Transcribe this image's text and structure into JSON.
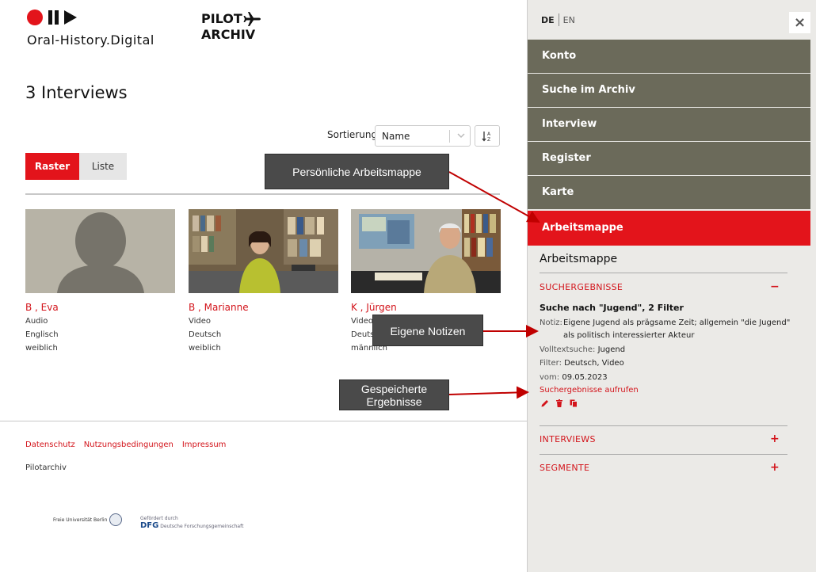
{
  "brand": {
    "ohd_text": "Oral-History.Digital",
    "pilot_line1": "PILOT",
    "pilot_line2": "ARCHIV"
  },
  "main": {
    "title": "3 Interviews",
    "sort_label": "Sortierung",
    "sort_value": "Name",
    "sort_button": "↓A Z",
    "view_raster": "Raster",
    "view_liste": "Liste"
  },
  "cards": [
    {
      "name": "B        , Eva",
      "media": "Audio",
      "language": "Englisch",
      "gender": "weiblich"
    },
    {
      "name": "B        , Marianne",
      "media": "Video",
      "language": "Deutsch",
      "gender": "weiblich"
    },
    {
      "name": "K           , Jürgen",
      "media": "Video",
      "language": "Deutsch",
      "gender": "männlich"
    }
  ],
  "footer": {
    "links": [
      "Datenschutz",
      "Nutzungsbedingungen",
      "Impressum"
    ],
    "brand": "Pilotarchiv",
    "fu_logo": "Freie Universität Berlin",
    "dfg_small": "Gefördert durch",
    "dfg_name": "DFG",
    "dfg_sub": "Deutsche Forschungsgemeinschaft"
  },
  "sidebar": {
    "lang_de": "DE",
    "lang_en": "EN",
    "close": "×",
    "nav": [
      "Konto",
      "Suche im Archiv",
      "Interview",
      "Register",
      "Karte",
      "Arbeitsmappe"
    ],
    "workbook_title": "Arbeitsmappe",
    "sections": {
      "results": "SUCHERGEBNISSE",
      "interviews": "INTERVIEWS",
      "segments": "SEGMENTE",
      "minus": "−",
      "plus": "+"
    },
    "saved_search": {
      "title": "Suche nach \"Jugend\", 2 Filter",
      "notiz_label": "Notiz:",
      "notiz_value": "Eigene Jugend als prägsame Zeit; allgemein \"die Jugend\" als politisch interessierter Akteur",
      "fulltext_label": "Volltextsuche:",
      "fulltext_value": "Jugend",
      "filter_label": "Filter:",
      "filter_value": "Deutsch, Video",
      "date_label": "vom:",
      "date_value": "09.05.2023",
      "open_link": "Suchergebnisse aufrufen"
    }
  },
  "callouts": {
    "workbook": "Persönliche Arbeitsmappe",
    "notes": "Eigene Notizen",
    "saved_line1": "Gespeicherte",
    "saved_line2": "Ergebnisse"
  },
  "colors": {
    "accent": "#e3141b",
    "nav_bg": "#6b6a5a",
    "sidebar_bg": "#ebeae7",
    "callout_bg": "#4a4a4a",
    "arrow": "#c00000"
  }
}
